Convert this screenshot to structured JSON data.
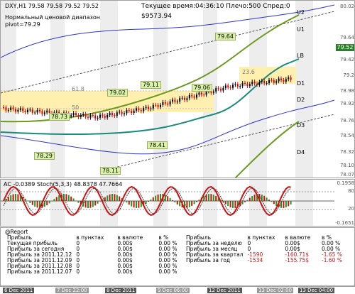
{
  "header": {
    "symbol_line": "DXY,H1  79.58 79.58 79.52 79.52",
    "range_line": "Нормальный ценовой диапазон",
    "pivot_line": "pivot=79.29",
    "server_time": "Текущее время:04:36:10 Плечо:500 Спред:0",
    "balance": "$9573.94"
  },
  "price_axis": [
    "80.02",
    "79.52",
    "79.64",
    "79.42",
    "79.2",
    "78.98",
    "78.92",
    "78.76",
    "78.54",
    "78.32",
    "78.10",
    "77.88",
    "78.07"
  ],
  "current_price": "79.52",
  "level_labels": {
    "U2": "U2",
    "U1": "U1",
    "LB": "LB",
    "D1": "D1",
    "D2": "D2",
    "D3": "D3",
    "D4": "D4"
  },
  "fib_labels": {
    "f618": "61.8",
    "f50": "50",
    "f236": "23.6"
  },
  "price_tags": [
    "79.64",
    "79.02",
    "79.11",
    "79.06",
    "78.73",
    "78.29",
    "78.41",
    "78.11"
  ],
  "oscillator": {
    "title": "AC -0.0389  Stoch(5,3,3) 48.8378 47.7664",
    "axis": [
      "0.1958",
      "80",
      "20",
      "-0.1651"
    ]
  },
  "report": {
    "title": "@Report",
    "left": {
      "headers": [
        "Прибыль",
        "в пунктах",
        "в валюте",
        "в %"
      ],
      "rows": [
        [
          "Текущая прибыль",
          "0",
          "0.00$",
          "0.00 %"
        ],
        [
          "Прибыль за сегодня",
          "0",
          "0.00$",
          "0.00 %"
        ],
        [
          "Прибыль за 2011.12.12",
          "0",
          "0.00$",
          "0.00 %"
        ],
        [
          "Прибыль за 2011.12.09",
          "0",
          "0.00$",
          "0.00 %"
        ],
        [
          "Прибыль за 2011.12.08",
          "0",
          "0.00$",
          "0.00 %"
        ],
        [
          "Прибыль за 2011.12.07",
          "0",
          "0.00$",
          "0.00 %"
        ]
      ]
    },
    "right": {
      "headers": [
        "Прибыль",
        "в пунктах",
        "в валюте",
        "в %"
      ],
      "rows": [
        [
          "Прибыль за неделю",
          "0",
          "0.00$",
          "0.00 %"
        ],
        [
          "Прибыль за месяц",
          "0",
          "0.00$",
          "0.00 %"
        ],
        [
          "Прибыль за квартал",
          "-1590",
          "-160.71$",
          "-1.65 %"
        ],
        [
          "Прибыль за год",
          "-1534",
          "-155.75$",
          "-1.60 %"
        ]
      ]
    }
  },
  "time_axis": [
    "6 Dec 2011",
    "7 Dec 22:00",
    "8 Dec 2011",
    "9 Dec 06:00",
    "12 Dec 2011",
    "13 Dec 02:00",
    "13 Dec 04:00"
  ],
  "colors": {
    "bull": "#000000",
    "bear": "#e00000",
    "ma_teal": "#1a8a7a",
    "ma_olive": "#6c9a1f",
    "band_blue": "#2c35d0",
    "zone": "#fff0b0"
  }
}
